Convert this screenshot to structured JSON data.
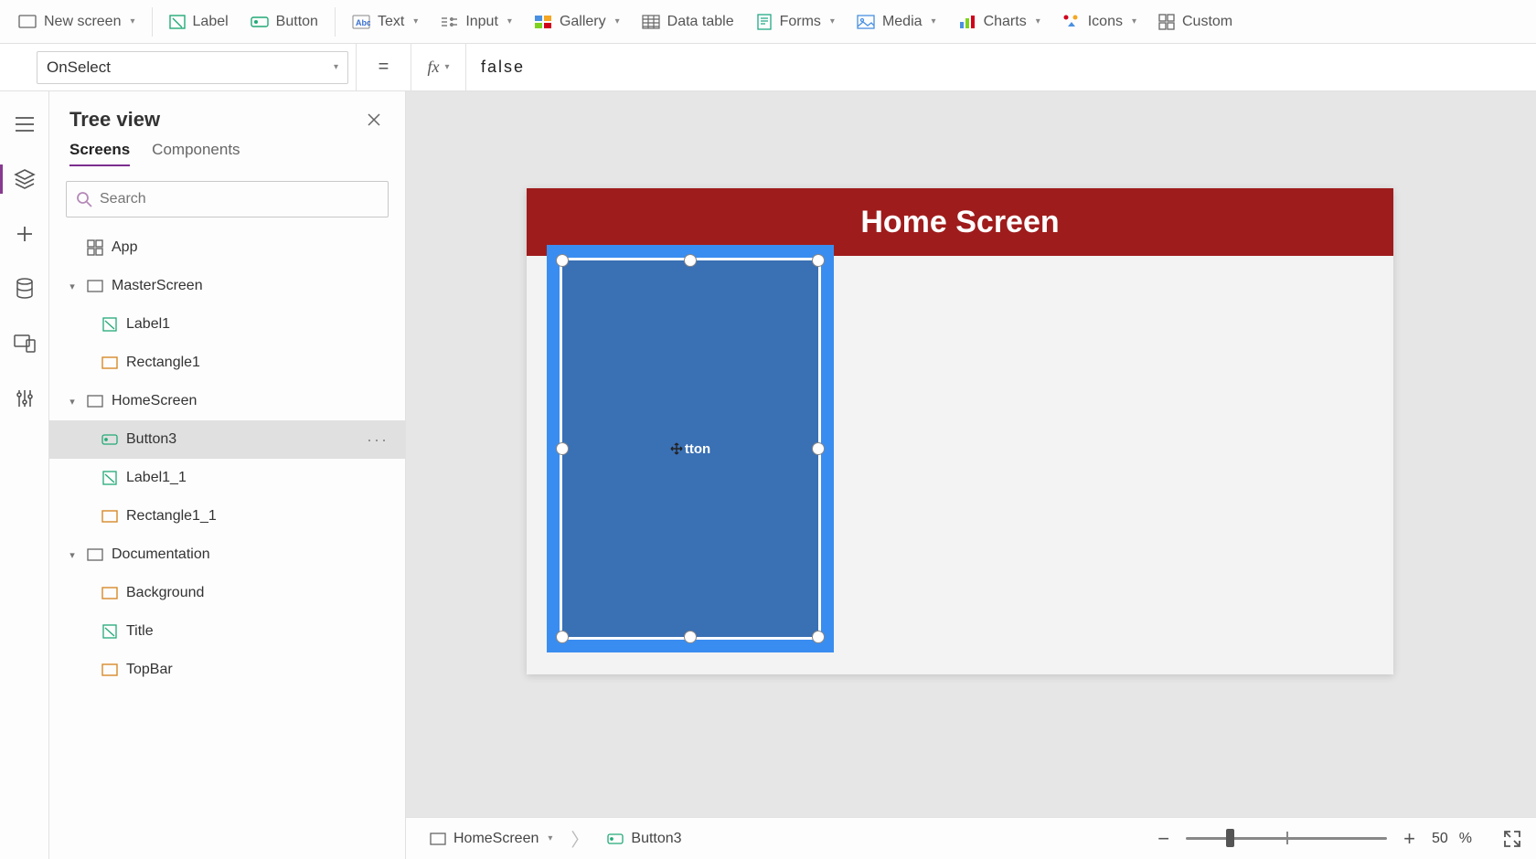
{
  "ribbon": {
    "new_screen": "New screen",
    "label": "Label",
    "button": "Button",
    "text": "Text",
    "input": "Input",
    "gallery": "Gallery",
    "data_table": "Data table",
    "forms": "Forms",
    "media": "Media",
    "charts": "Charts",
    "icons": "Icons",
    "custom": "Custom"
  },
  "formula": {
    "property": "OnSelect",
    "equals": "=",
    "fx": "fx",
    "value": "false"
  },
  "tree": {
    "title": "Tree view",
    "tabs": {
      "screens": "Screens",
      "components": "Components"
    },
    "search_placeholder": "Search",
    "items": {
      "app": "App",
      "master": "MasterScreen",
      "label1": "Label1",
      "rect1": "Rectangle1",
      "home": "HomeScreen",
      "button3": "Button3",
      "label1_1": "Label1_1",
      "rect1_1": "Rectangle1_1",
      "doc": "Documentation",
      "background": "Background",
      "title_item": "Title",
      "topbar": "TopBar"
    }
  },
  "canvas": {
    "header_title": "Home Screen",
    "button_text": "tton"
  },
  "breadcrumb": {
    "screen": "HomeScreen",
    "element": "Button3"
  },
  "zoom": {
    "value": "50",
    "pct": "%"
  }
}
